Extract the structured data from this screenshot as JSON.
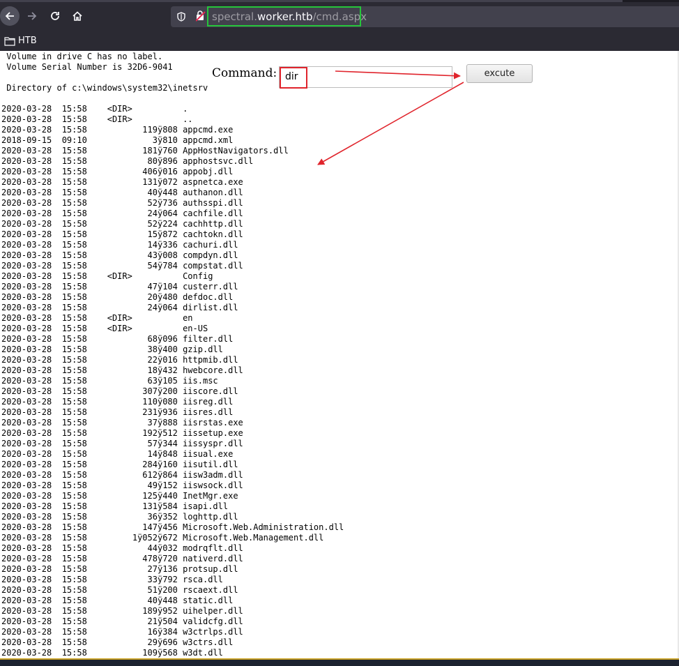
{
  "browser": {
    "url_prefix": "spectral.",
    "url_host": "worker.htb",
    "url_path": "/cmd.aspx",
    "bookmark": "HTB",
    "icons": [
      "back-icon",
      "forward-icon",
      "reload-icon",
      "home-icon",
      "shield-icon",
      "broken-lock-icon",
      "folder-icon"
    ]
  },
  "page": {
    "command_label": "Command:",
    "command_value": "dir",
    "execute_label": "excute",
    "annotation_color": "#e0242c",
    "highlight_color": "#26c53b",
    "output": " Volume in drive C has no label.\n Volume Serial Number is 32D6-9041\n\n Directory of c:\\windows\\system32\\inetsrv\n\n2020-03-28  15:58    <DIR>          .\n2020-03-28  15:58    <DIR>          ..\n2020-03-28  15:58           119ÿ808 appcmd.exe\n2018-09-15  09:10             3ÿ810 appcmd.xml\n2020-03-28  15:58           181ÿ760 AppHostNavigators.dll\n2020-03-28  15:58            80ÿ896 apphostsvc.dll\n2020-03-28  15:58           406ÿ016 appobj.dll\n2020-03-28  15:58           131ÿ072 aspnetca.exe\n2020-03-28  15:58            40ÿ448 authanon.dll\n2020-03-28  15:58            52ÿ736 authsspi.dll\n2020-03-28  15:58            24ÿ064 cachfile.dll\n2020-03-28  15:58            52ÿ224 cachhttp.dll\n2020-03-28  15:58            15ÿ872 cachtokn.dll\n2020-03-28  15:58            14ÿ336 cachuri.dll\n2020-03-28  15:58            43ÿ008 compdyn.dll\n2020-03-28  15:58            54ÿ784 compstat.dll\n2020-03-28  15:58    <DIR>          Config\n2020-03-28  15:58            47ÿ104 custerr.dll\n2020-03-28  15:58            20ÿ480 defdoc.dll\n2020-03-28  15:58            24ÿ064 dirlist.dll\n2020-03-28  15:58    <DIR>          en\n2020-03-28  15:58    <DIR>          en-US\n2020-03-28  15:58            68ÿ096 filter.dll\n2020-03-28  15:58            38ÿ400 gzip.dll\n2020-03-28  15:58            22ÿ016 httpmib.dll\n2020-03-28  15:58            18ÿ432 hwebcore.dll\n2020-03-28  15:58            63ÿ105 iis.msc\n2020-03-28  15:58           307ÿ200 iiscore.dll\n2020-03-28  15:58           110ÿ080 iisreg.dll\n2020-03-28  15:58           231ÿ936 iisres.dll\n2020-03-28  15:58            37ÿ888 iisrstas.exe\n2020-03-28  15:58           192ÿ512 iissetup.exe\n2020-03-28  15:58            57ÿ344 iissyspr.dll\n2020-03-28  15:58            14ÿ848 iisual.exe\n2020-03-28  15:58           284ÿ160 iisutil.dll\n2020-03-28  15:58           612ÿ864 iisw3adm.dll\n2020-03-28  15:58            49ÿ152 iiswsock.dll\n2020-03-28  15:58           125ÿ440 InetMgr.exe\n2020-03-28  15:58           131ÿ584 isapi.dll\n2020-03-28  15:58            36ÿ352 loghttp.dll\n2020-03-28  15:58           147ÿ456 Microsoft.Web.Administration.dll\n2020-03-28  15:58         1ÿ052ÿ672 Microsoft.Web.Management.dll\n2020-03-28  15:58            44ÿ032 modrqflt.dll\n2020-03-28  15:58           478ÿ720 nativerd.dll\n2020-03-28  15:58            27ÿ136 protsup.dll\n2020-03-28  15:58            33ÿ792 rsca.dll\n2020-03-28  15:58            51ÿ200 rscaext.dll\n2020-03-28  15:58            40ÿ448 static.dll\n2020-03-28  15:58           189ÿ952 uihelper.dll\n2020-03-28  15:58            21ÿ504 validcfg.dll\n2020-03-28  15:58            16ÿ384 w3ctrlps.dll\n2020-03-28  15:58            29ÿ696 w3ctrs.dll\n2020-03-28  15:58           109ÿ568 w3dt.dll"
  }
}
